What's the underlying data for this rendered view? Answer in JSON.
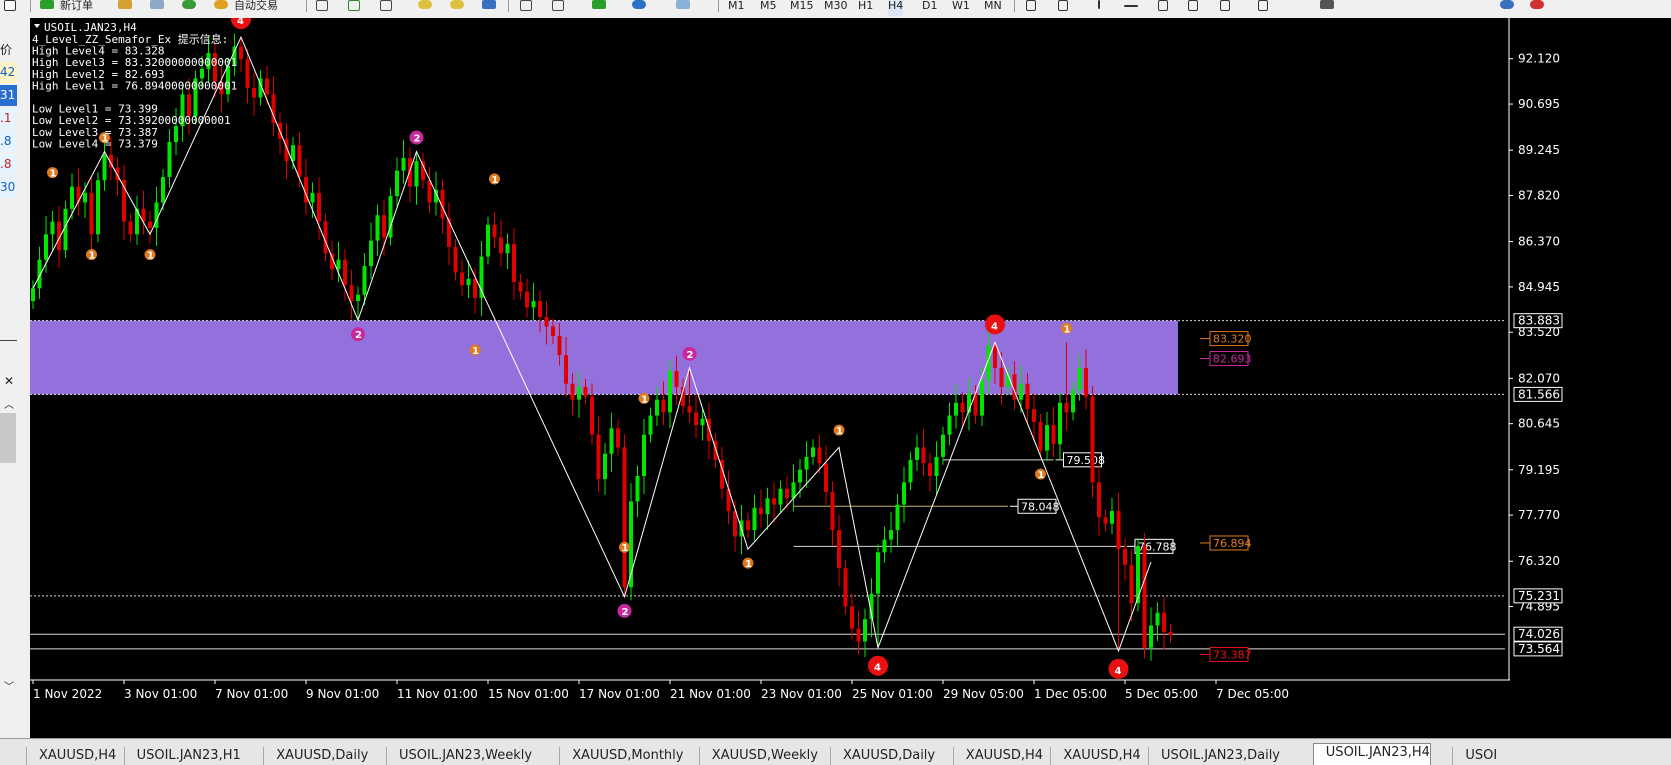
{
  "toolbar": {
    "new_order_label": "新订单",
    "auto_trade_label": "自动交易",
    "timeframes": [
      "M1",
      "M5",
      "M15",
      "M30",
      "H1",
      "H4",
      "D1",
      "W1",
      "MN"
    ]
  },
  "left_panel": {
    "header": "价",
    "values": [
      {
        "text": "42",
        "color": "#1060c0",
        "bg": "#fff3c8"
      },
      {
        "text": "31",
        "color": "#ffffff",
        "bg": "#2a6fd0"
      },
      {
        "text": ".1",
        "color": "#c02020",
        "bg": "#e6f4ff"
      },
      {
        "text": ".8",
        "color": "#1060c0",
        "bg": "#e6f4ff"
      },
      {
        "text": ".8",
        "color": "#c02020",
        "bg": "#e6f4ff"
      },
      {
        "text": "30",
        "color": "#1060c0",
        "bg": "#e6f4ff"
      }
    ]
  },
  "chart": {
    "symbol_title": "USOIL.JAN23,H4",
    "indicator_lines": [
      "4_Level_ZZ_Semafor_Ex 提示信息:",
      "High Level4 = 83.328",
      "High Level3 = 83.32000000000001",
      "High Level2 = 82.693",
      "High Level1 = 76.89400000000001",
      "",
      "Low Level1 = 73.399",
      "Low Level2 = 73.39200000000001",
      "Low Level3 = 73.387",
      "Low Level4 = 73.379"
    ],
    "colors": {
      "bg": "#000000",
      "bull": "#00e600",
      "bear": "#e00000",
      "zone": "#9370DB",
      "sema1": "#e07a20",
      "sema2": "#c8289c",
      "sema4": "#e81010"
    }
  },
  "chart_data": {
    "type": "candlestick",
    "ylim": [
      72.9,
      93.4
    ],
    "y_ticks": [
      "92.120",
      "90.695",
      "89.245",
      "87.820",
      "86.370",
      "84.945",
      "83.520",
      "82.070",
      "80.645",
      "79.195",
      "77.770",
      "76.320",
      "74.895"
    ],
    "x_ticks": [
      "1 Nov 2022",
      "3 Nov 01:00",
      "7 Nov 01:00",
      "9 Nov 01:00",
      "11 Nov 01:00",
      "15 Nov 01:00",
      "17 Nov 01:00",
      "21 Nov 01:00",
      "23 Nov 01:00",
      "25 Nov 01:00",
      "29 Nov 05:00",
      "1 Dec 05:00",
      "5 Dec 05:00",
      "7 Dec 05:00"
    ],
    "price_labels": [
      {
        "value": 83.883,
        "text": "83.883",
        "style": "dotted"
      },
      {
        "value": 81.566,
        "text": "81.566",
        "style": "dotted"
      },
      {
        "value": 75.231,
        "text": "75.231",
        "style": "dotted"
      },
      {
        "value": 74.026,
        "text": "74.026",
        "style": "solid"
      },
      {
        "value": 73.564,
        "text": "73.564",
        "style": "solid"
      }
    ],
    "zone": {
      "from": 81.566,
      "to": 83.883
    },
    "level_labels": [
      {
        "value": 83.32,
        "text": "83.320",
        "color": "#e07a20"
      },
      {
        "value": 82.693,
        "text": "82.693",
        "color": "#c8289c"
      },
      {
        "value": 76.894,
        "text": "76.894",
        "color": "#e07a20"
      },
      {
        "value": 73.387,
        "text": "73.387",
        "color": "#e81010"
      }
    ],
    "h_lines": [
      {
        "value": 79.508,
        "text": "79.508"
      },
      {
        "value": 78.048,
        "text": "78.048"
      },
      {
        "value": 76.788,
        "text": "76.788"
      }
    ],
    "zigzag": [
      [
        0,
        84.9
      ],
      [
        11,
        89.2
      ],
      [
        18,
        86.6
      ],
      [
        32,
        92.8
      ],
      [
        50,
        83.9
      ],
      [
        59,
        89.2
      ],
      [
        91,
        75.2
      ],
      [
        101,
        82.4
      ],
      [
        110,
        76.7
      ],
      [
        124,
        79.9
      ],
      [
        130,
        73.6
      ],
      [
        148,
        83.2
      ],
      [
        167,
        73.5
      ],
      [
        172,
        76.3
      ]
    ],
    "semafor": [
      {
        "i": 3,
        "v": 88.1,
        "level": 1,
        "pos": "above"
      },
      {
        "i": 9,
        "v": 86.4,
        "level": 1,
        "pos": "below"
      },
      {
        "i": 11,
        "v": 89.2,
        "level": 1,
        "pos": "above"
      },
      {
        "i": 18,
        "v": 86.4,
        "level": 1,
        "pos": "below"
      },
      {
        "i": 32,
        "v": 92.8,
        "level": 4,
        "pos": "above"
      },
      {
        "i": 50,
        "v": 83.9,
        "level": 2,
        "pos": "below"
      },
      {
        "i": 59,
        "v": 89.2,
        "level": 2,
        "pos": "above"
      },
      {
        "i": 71,
        "v": 87.9,
        "level": 1,
        "pos": "above"
      },
      {
        "i": 68,
        "v": 83.4,
        "level": 1,
        "pos": "below"
      },
      {
        "i": 91,
        "v": 77.2,
        "level": 1,
        "pos": "below"
      },
      {
        "i": 94,
        "v": 81.0,
        "level": 1,
        "pos": "above"
      },
      {
        "i": 91,
        "v": 75.2,
        "level": 2,
        "pos": "below"
      },
      {
        "i": 101,
        "v": 82.4,
        "level": 2,
        "pos": "above"
      },
      {
        "i": 110,
        "v": 76.7,
        "level": 1,
        "pos": "below"
      },
      {
        "i": 124,
        "v": 80.0,
        "level": 1,
        "pos": "above"
      },
      {
        "i": 130,
        "v": 73.6,
        "level": 4,
        "pos": "below"
      },
      {
        "i": 148,
        "v": 83.2,
        "level": 4,
        "pos": "above"
      },
      {
        "i": 155,
        "v": 79.5,
        "level": 1,
        "pos": "below"
      },
      {
        "i": 159,
        "v": 83.2,
        "level": 1,
        "pos": "above"
      },
      {
        "i": 167,
        "v": 73.5,
        "level": 4,
        "pos": "below"
      }
    ],
    "closes": [
      84.9,
      85.8,
      86.6,
      87.0,
      86.1,
      87.4,
      88.1,
      87.6,
      87.9,
      86.6,
      88.3,
      89.1,
      88.7,
      88.3,
      87.0,
      86.6,
      87.4,
      87.0,
      86.8,
      87.6,
      88.4,
      89.5,
      90.0,
      91.0,
      90.3,
      91.5,
      91.8,
      92.3,
      91.4,
      91.0,
      91.9,
      92.5,
      92.1,
      91.2,
      90.9,
      91.5,
      91.0,
      90.1,
      89.6,
      88.9,
      89.4,
      88.4,
      87.6,
      87.9,
      87.0,
      86.0,
      85.5,
      85.8,
      85.0,
      84.5,
      84.7,
      85.6,
      86.4,
      87.2,
      86.5,
      87.8,
      88.6,
      89.0,
      88.1,
      88.9,
      88.3,
      87.6,
      88.0,
      87.1,
      86.2,
      85.4,
      85.0,
      85.2,
      84.6,
      85.9,
      86.9,
      86.5,
      86.0,
      86.3,
      85.1,
      84.8,
      84.3,
      84.5,
      84.0,
      83.7,
      83.4,
      82.8,
      81.9,
      81.4,
      81.8,
      81.5,
      80.3,
      78.9,
      79.7,
      80.5,
      79.9,
      75.5,
      78.2,
      79.0,
      80.3,
      80.9,
      81.4,
      81.0,
      82.3,
      81.8,
      81.2,
      81.0,
      80.6,
      80.8,
      80.1,
      79.5,
      78.6,
      77.9,
      77.1,
      77.6,
      77.3,
      78.0,
      77.8,
      78.3,
      78.1,
      78.6,
      78.3,
      78.8,
      79.2,
      79.6,
      79.9,
      79.4,
      78.5,
      77.3,
      76.1,
      74.9,
      74.2,
      73.8,
      74.5,
      75.3,
      76.6,
      77.0,
      77.3,
      78.1,
      78.8,
      79.5,
      79.9,
      79.4,
      79.0,
      79.6,
      80.3,
      80.9,
      81.3,
      81.0,
      81.6,
      80.9,
      82.0,
      83.1,
      82.4,
      81.8,
      82.2,
      81.4,
      81.9,
      81.1,
      80.7,
      79.8,
      80.6,
      80.0,
      81.3,
      81.0,
      81.7,
      82.4,
      81.5,
      78.8,
      77.7,
      77.5,
      77.9,
      76.7,
      76.2,
      75.0,
      76.8,
      73.6,
      74.3,
      74.7,
      74.1,
      74.0
    ],
    "highs": {
      "32": 92.8,
      "59": 89.2,
      "101": 82.4,
      "148": 83.2,
      "159": 83.2
    },
    "lows": {
      "50": 83.9,
      "91": 75.2,
      "130": 73.6,
      "167": 73.5
    }
  },
  "tabs": [
    {
      "label": "XAUUSD,H4",
      "active": false
    },
    {
      "label": "USOIL.JAN23,H1",
      "active": false
    },
    {
      "label": "XAUUSD,Daily",
      "active": false
    },
    {
      "label": "USOIL.JAN23,Weekly",
      "active": false
    },
    {
      "label": "XAUUSD,Monthly",
      "active": false
    },
    {
      "label": "XAUUSD,Weekly",
      "active": false
    },
    {
      "label": "XAUUSD,Daily",
      "active": false
    },
    {
      "label": "XAUUSD,H4",
      "active": false
    },
    {
      "label": "XAUUSD,H4",
      "active": false
    },
    {
      "label": "USOIL.JAN23,Daily",
      "active": false
    },
    {
      "label": "USOIL.JAN23,H4",
      "active": true
    },
    {
      "label": "USOI",
      "active": false
    }
  ]
}
